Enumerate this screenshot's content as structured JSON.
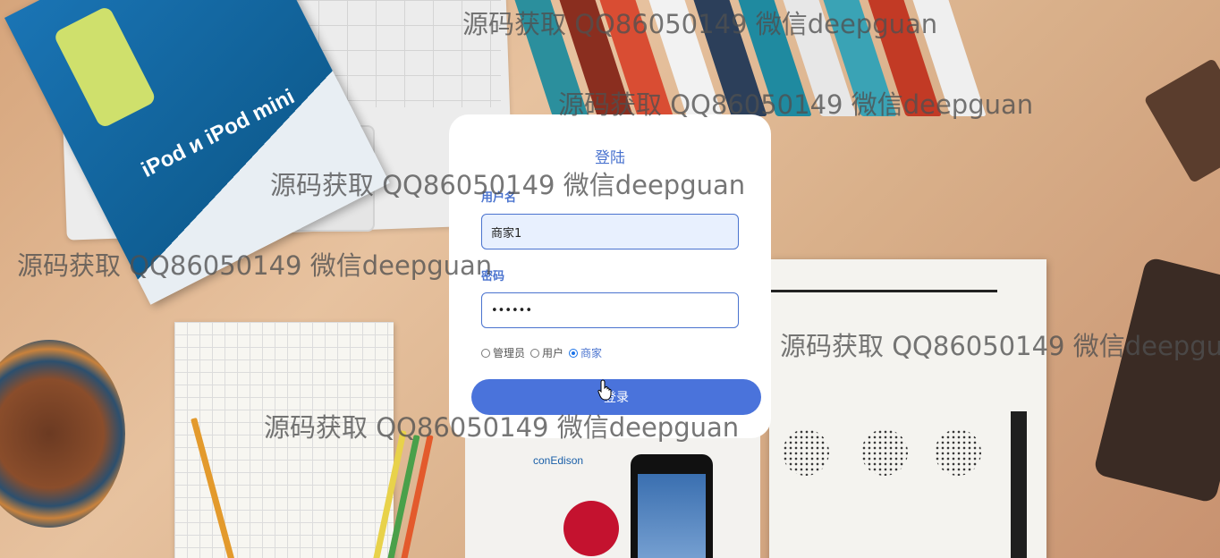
{
  "login": {
    "title": "登陆",
    "username_label": "用户名",
    "username_value": "商家1",
    "password_label": "密码",
    "password_value": "123456",
    "roles": [
      {
        "label": "管理员",
        "checked": false
      },
      {
        "label": "用户",
        "checked": false
      },
      {
        "label": "商家",
        "checked": true
      }
    ],
    "submit_label": "登录"
  },
  "watermark_text": "源码获取 QQ86050149 微信deepguan",
  "background": {
    "ipod_title": "iPod и iPod mini",
    "brand_conedison": "conEdison"
  },
  "colors": {
    "accent": "#4a73db",
    "label": "#4a73cf",
    "card": "#ffffff"
  }
}
